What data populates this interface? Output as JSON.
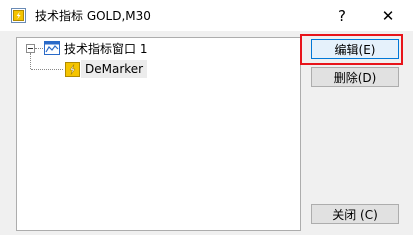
{
  "window": {
    "title": "技术指标 GOLD,M30",
    "help_label": "?",
    "close_label": "✕"
  },
  "tree": {
    "root": {
      "label": "技术指标窗口 1",
      "icon": "chart-window-icon"
    },
    "children": [
      {
        "label": "DeMarker",
        "icon": "indicator-icon"
      }
    ]
  },
  "buttons": {
    "edit": "编辑(E)",
    "delete": "删除(D)",
    "close": "关闭 (C)"
  },
  "colors": {
    "highlight_border": "#e8141a",
    "focus_border": "#0078d7",
    "icon_yellow": "#f5c400"
  }
}
